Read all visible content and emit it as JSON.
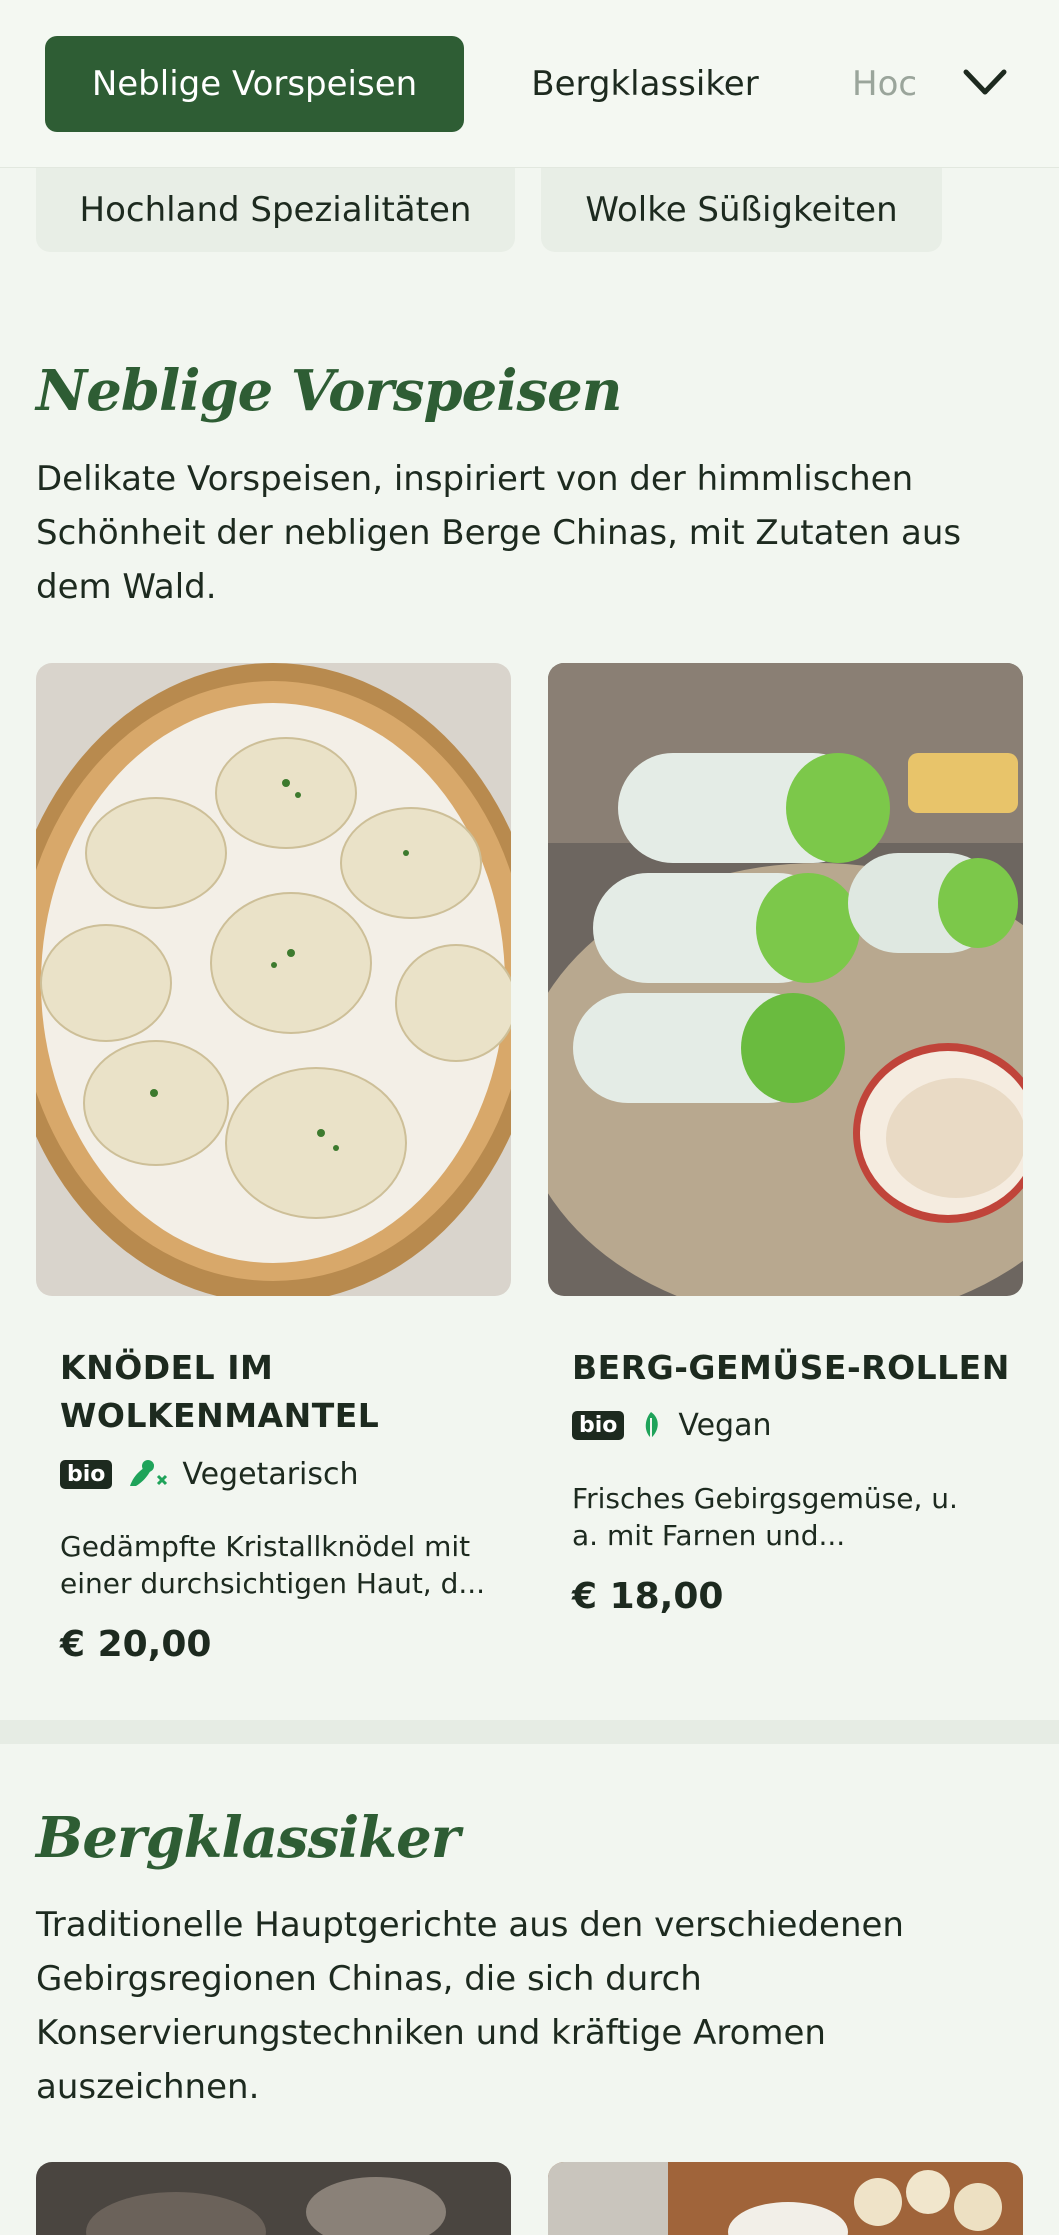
{
  "nav": {
    "tabs": [
      {
        "label": "Neblige Vorspeisen"
      },
      {
        "label": "Bergklassiker"
      },
      {
        "label": "Hoc"
      }
    ],
    "expand_icon": "chevron-down-icon"
  },
  "category_pills": [
    {
      "label": "Hochland Spezialitäten"
    },
    {
      "label": "Wolke Süßigkeiten"
    }
  ],
  "sections": [
    {
      "title": "Neblige Vorspeisen",
      "description": "Delikate Vorspeisen, inspiriert von der himmlischen Schönheit der nebligen Berge Chinas, mit Zutaten aus dem Wald.",
      "items": [
        {
          "name": "KNÖDEL IM WOLKENMANTEL",
          "badge": "bio",
          "diet_icon": "vegetarian-icon",
          "diet": "Vegetarisch",
          "description": "Gedämpfte Kristallknödel mit einer durchsichtigen Haut, d...",
          "price": "€ 20,00"
        },
        {
          "name": "BERG-GEMÜSE-ROLLEN",
          "badge": "bio",
          "diet_icon": "leaf-icon",
          "diet": "Vegan",
          "description": "Frisches Gebirgsgemüse, u. a. mit Farnen und...",
          "price": "€ 18,00"
        }
      ]
    },
    {
      "title": "Bergklassiker",
      "description": "Traditionelle Hauptgerichte aus den verschiedenen Gebirgsregionen Chinas, die sich durch Konservierungstechniken und kräftige Aromen auszeichnen."
    }
  ],
  "colors": {
    "accent": "#2e5d34",
    "background": "#f2f6f0",
    "diet_icon": "#1fa35a"
  }
}
